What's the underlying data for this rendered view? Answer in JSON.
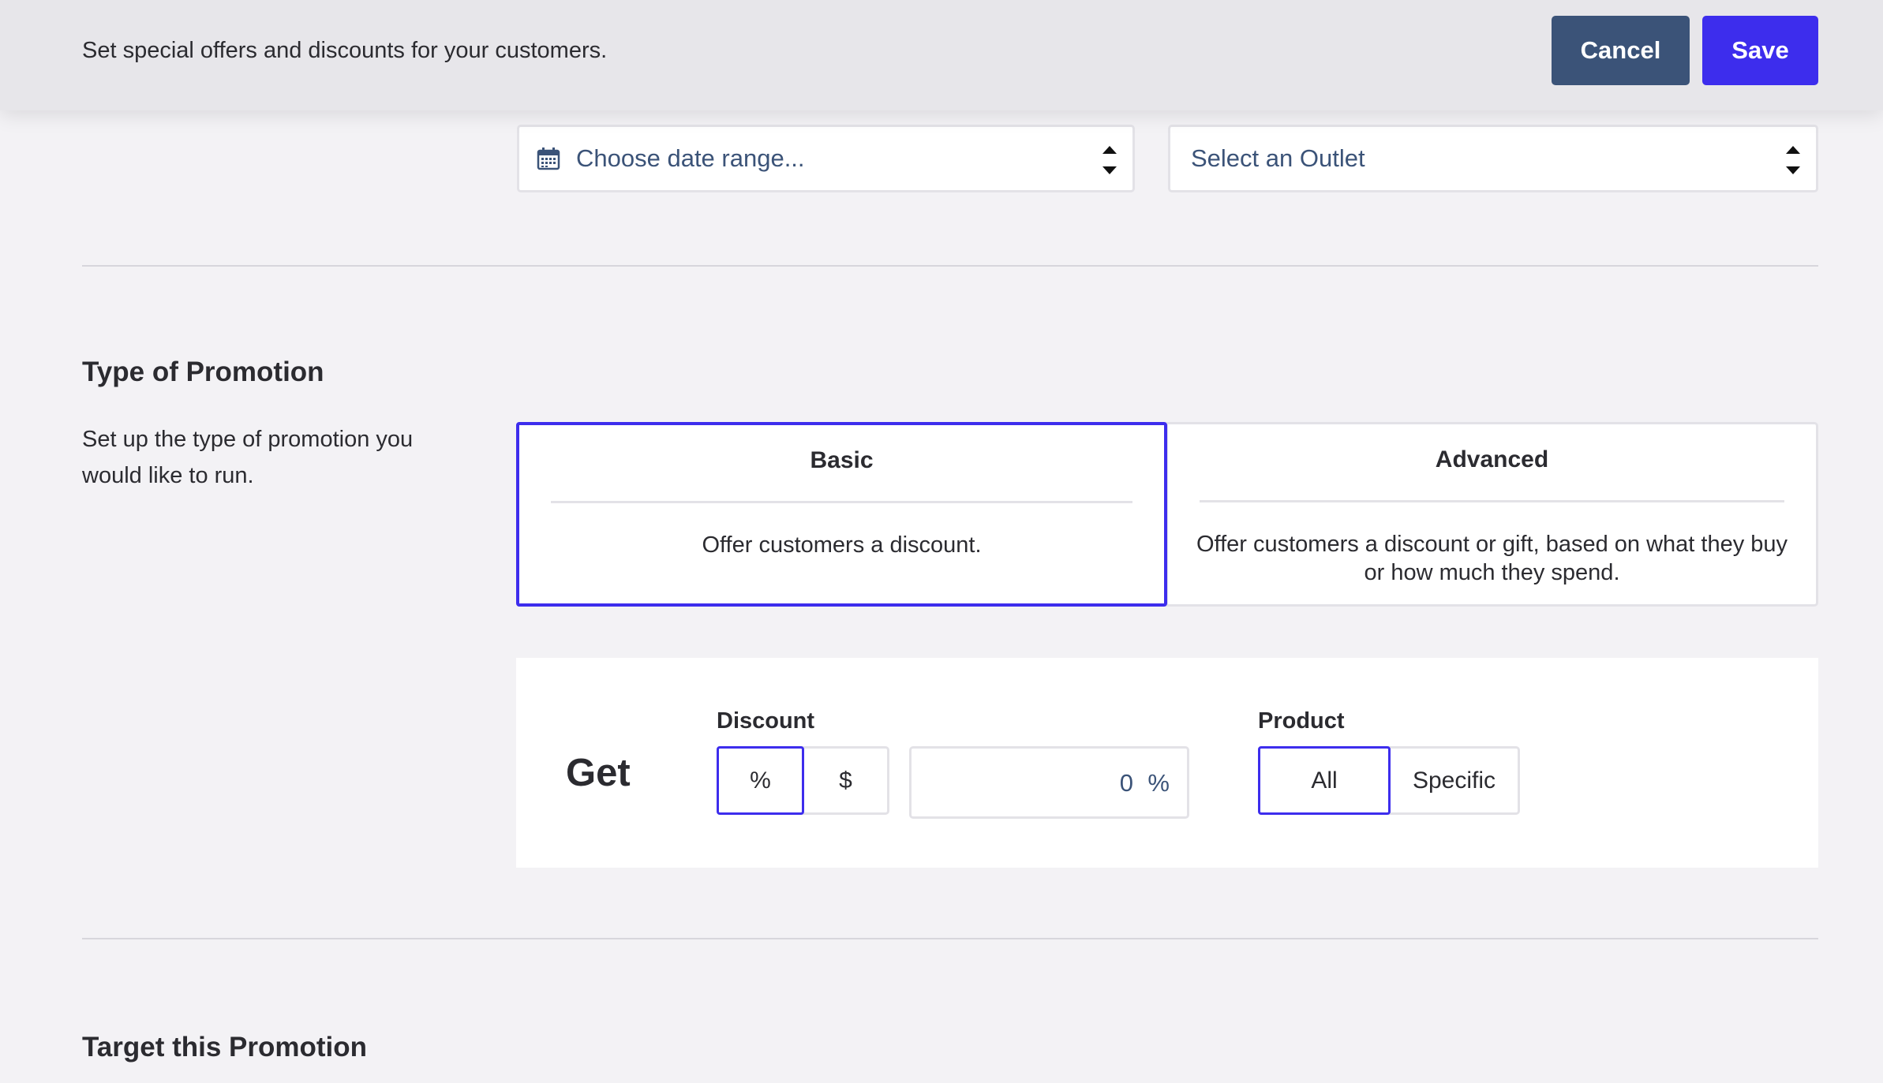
{
  "header": {
    "subtitle": "Set special offers and discounts for your customers.",
    "cancel_label": "Cancel",
    "save_label": "Save"
  },
  "filters": {
    "date_range_placeholder": "Choose date range...",
    "outlet_placeholder": "Select an Outlet"
  },
  "promotion_type": {
    "title": "Type of Promotion",
    "description": "Set up the type of promotion you would like to run.",
    "options": [
      {
        "title": "Basic",
        "description": "Offer customers a discount.",
        "selected": true
      },
      {
        "title": "Advanced",
        "description": "Offer customers a discount or gift, based on what they buy or how much they spend.",
        "selected": false
      }
    ]
  },
  "get": {
    "label": "Get",
    "discount": {
      "label": "Discount",
      "options": [
        "%",
        "$"
      ],
      "selected": "%",
      "value": "0",
      "unit": "%"
    },
    "product": {
      "label": "Product",
      "options": [
        "All",
        "Specific"
      ],
      "selected": "All"
    }
  },
  "target": {
    "title": "Target this Promotion"
  },
  "colors": {
    "accent": "#3d2ded",
    "secondary": "#3b5378",
    "background": "#f3f2f5"
  }
}
